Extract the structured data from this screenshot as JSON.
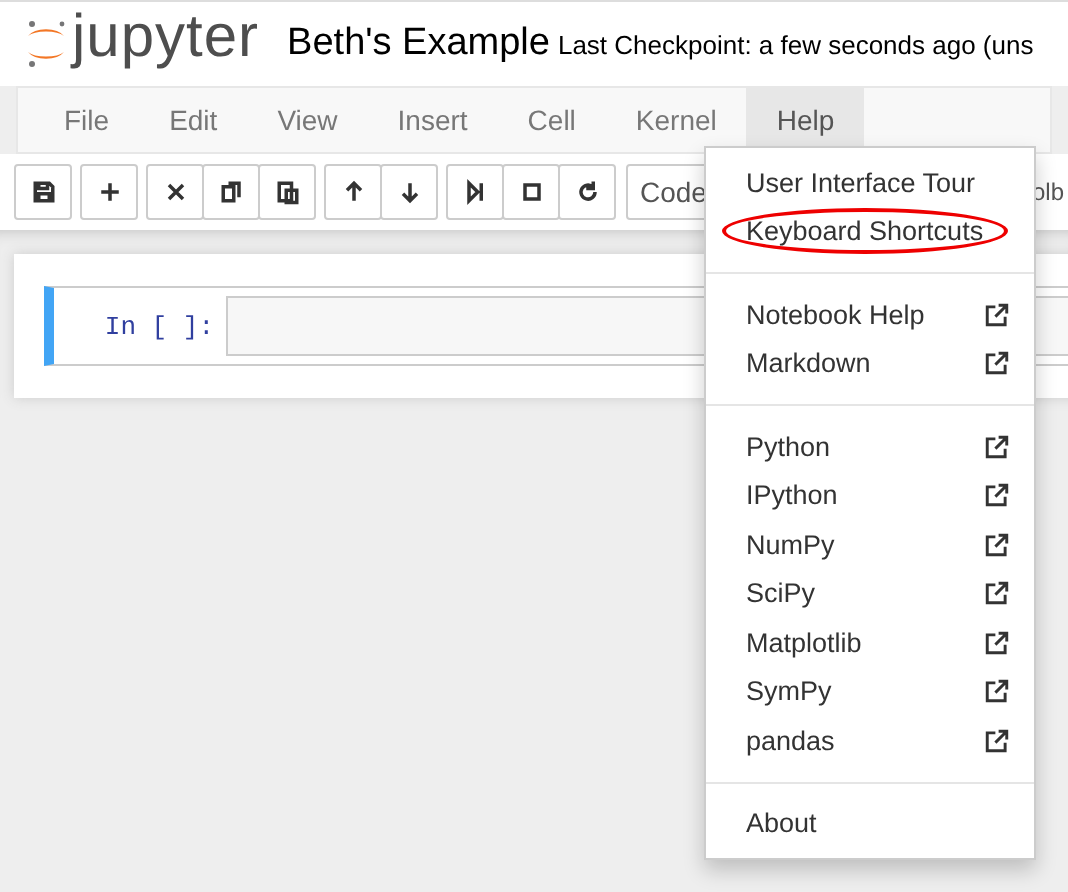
{
  "header": {
    "logo_text": "jupyter",
    "notebook_title": "Beth's Example",
    "checkpoint": "Last Checkpoint: a few seconds ago (uns"
  },
  "menubar": [
    {
      "label": "File",
      "selected": false
    },
    {
      "label": "Edit",
      "selected": false
    },
    {
      "label": "View",
      "selected": false
    },
    {
      "label": "Insert",
      "selected": false
    },
    {
      "label": "Cell",
      "selected": false
    },
    {
      "label": "Kernel",
      "selected": false
    },
    {
      "label": "Help",
      "selected": true
    }
  ],
  "toolbar": {
    "groups": [
      [
        {
          "kind": "save"
        }
      ],
      [
        {
          "kind": "add"
        }
      ],
      [
        {
          "kind": "cut"
        },
        {
          "kind": "copy"
        },
        {
          "kind": "paste"
        }
      ],
      [
        {
          "kind": "up"
        },
        {
          "kind": "down"
        }
      ],
      [
        {
          "kind": "run"
        },
        {
          "kind": "stop"
        },
        {
          "kind": "restart"
        }
      ]
    ],
    "cell_type": "Code",
    "cut_text": "olb"
  },
  "cell": {
    "prompt": "In [ ]:"
  },
  "help_menu": [
    [
      {
        "label": "User Interface Tour",
        "external": false,
        "circled": false
      },
      {
        "label": "Keyboard Shortcuts",
        "external": false,
        "circled": true
      }
    ],
    [
      {
        "label": "Notebook Help",
        "external": true,
        "circled": false
      },
      {
        "label": "Markdown",
        "external": true,
        "circled": false
      }
    ],
    [
      {
        "label": "Python",
        "external": true,
        "circled": false
      },
      {
        "label": "IPython",
        "external": true,
        "circled": false
      },
      {
        "label": "NumPy",
        "external": true,
        "circled": false
      },
      {
        "label": "SciPy",
        "external": true,
        "circled": false
      },
      {
        "label": "Matplotlib",
        "external": true,
        "circled": false
      },
      {
        "label": "SymPy",
        "external": true,
        "circled": false
      },
      {
        "label": "pandas",
        "external": true,
        "circled": false
      }
    ],
    [
      {
        "label": "About",
        "external": false,
        "circled": false
      }
    ]
  ]
}
